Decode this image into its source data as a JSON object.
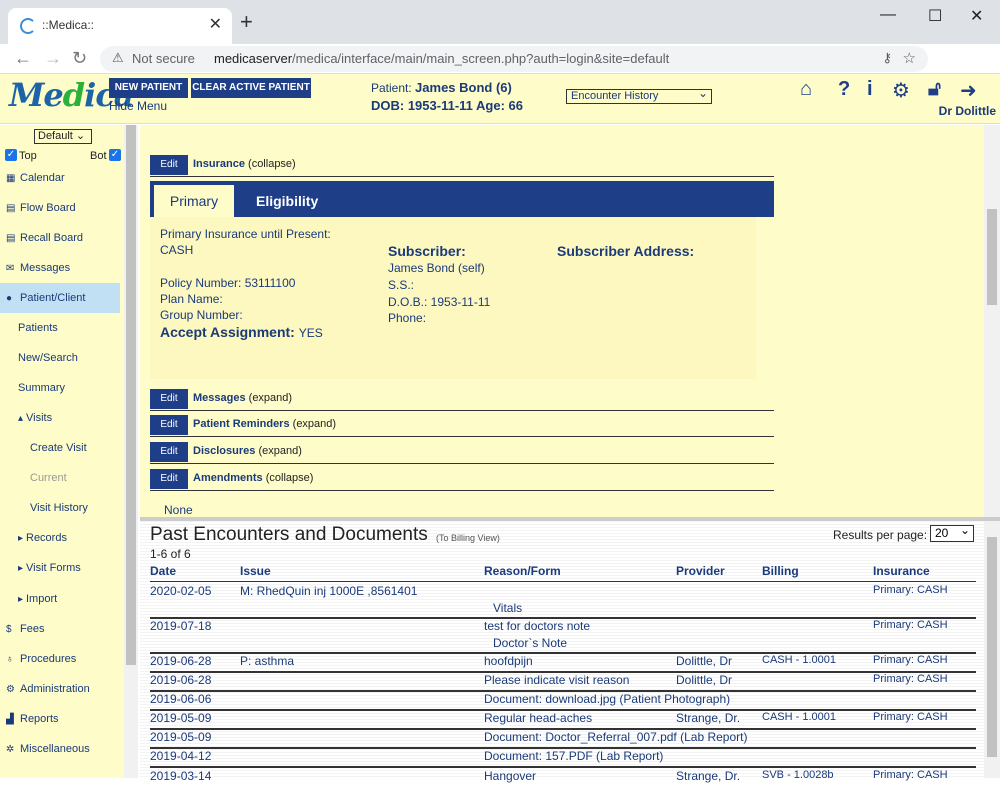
{
  "browser": {
    "tab_title": "::Medica::",
    "not_secure": "Not secure",
    "url_host": "medicaserver",
    "url_path": "/medica/interface/main/main_screen.php?auth=login&site=default"
  },
  "header": {
    "logo_a": "Me",
    "logo_b": "d",
    "logo_c": "ica",
    "new_patient": "NEW PATIENT",
    "clear_patient": "CLEAR ACTIVE PATIENT",
    "hide_menu": "Hide Menu",
    "patient_label": "Patient:",
    "patient_name": "James Bond (6)",
    "dob_line": "DOB: 1953-11-11 Age: 66",
    "encounter_select": "Encounter History",
    "user": "Dr Dolittle"
  },
  "sidebar": {
    "select": "Default",
    "top_label": "Top",
    "bot_label": "Bot",
    "items": [
      {
        "label": "Calendar",
        "icon": "calendar-icon",
        "glyph": "▦"
      },
      {
        "label": "Flow Board",
        "icon": "board-icon",
        "glyph": "▤"
      },
      {
        "label": "Recall Board",
        "icon": "board-icon",
        "glyph": "▤"
      },
      {
        "label": "Messages",
        "icon": "envelope-icon",
        "glyph": "✉"
      },
      {
        "label": "Patient/Client",
        "icon": "user-icon",
        "glyph": "●"
      },
      {
        "label": "Patients"
      },
      {
        "label": "New/Search"
      },
      {
        "label": "Summary"
      },
      {
        "label": "Visits",
        "glyph": "▴"
      },
      {
        "label": "Create Visit"
      },
      {
        "label": "Current"
      },
      {
        "label": "Visit History"
      },
      {
        "label": "Records",
        "glyph": "▸"
      },
      {
        "label": "Visit Forms",
        "glyph": "▸"
      },
      {
        "label": "Import",
        "glyph": "▸"
      },
      {
        "label": "Fees",
        "icon": "dollar-icon",
        "glyph": "$"
      },
      {
        "label": "Procedures",
        "icon": "stethoscope-icon",
        "glyph": "♁"
      },
      {
        "label": "Administration",
        "icon": "cogs-icon",
        "glyph": "⚙"
      },
      {
        "label": "Reports",
        "icon": "chart-icon",
        "glyph": "▟"
      },
      {
        "label": "Miscellaneous",
        "icon": "gear-icon",
        "glyph": "✲"
      }
    ]
  },
  "insurance": {
    "edit": "Edit",
    "title": "Insurance",
    "state": "(collapse)",
    "tab_primary": "Primary",
    "tab_eligibility": "Eligibility",
    "until": "Primary Insurance until Present:",
    "company": "CASH",
    "policy": "Policy Number: 53111100",
    "plan": "Plan Name:",
    "group": "Group Number:",
    "accept_label": "Accept Assignment:",
    "accept_value": "YES",
    "subscriber_head": "Subscriber:",
    "subscriber_name": "James Bond (self)",
    "ss": "S.S.:",
    "dob": "D.O.B.: 1953-11-11",
    "phone": "Phone:",
    "address_head": "Subscriber Address:"
  },
  "sections": [
    {
      "title": "Messages",
      "state": "(expand)"
    },
    {
      "title": "Patient Reminders",
      "state": "(expand)"
    },
    {
      "title": "Disclosures",
      "state": "(expand)"
    },
    {
      "title": "Amendments",
      "state": "(collapse)"
    }
  ],
  "none_text": "None",
  "encounters": {
    "title": "Past Encounters and Documents",
    "billing_view": "(To Billing View)",
    "results_label": "Results per page:",
    "results_value": "20",
    "count": "1-6 of 6",
    "headers": [
      "Date",
      "Issue",
      "Reason/Form",
      "Provider",
      "Billing",
      "Insurance"
    ],
    "rows": [
      {
        "date": "2020-02-05",
        "issue": "M: RhedQuin inj 1000E ,8561401",
        "reason": "",
        "sub": "Vitals",
        "provider": "",
        "billing": "",
        "insurance": "Primary: CASH"
      },
      {
        "date": "2019-07-18",
        "issue": "",
        "reason": "test for doctors note",
        "sub": "Doctor`s Note",
        "provider": "",
        "billing": "",
        "insurance": "Primary: CASH"
      },
      {
        "date": "2019-06-28",
        "issue": "P: asthma",
        "reason": "hoofdpijn",
        "sub": "",
        "provider": "Dolittle, Dr",
        "billing": "CASH - 1.0001",
        "insurance": "Primary: CASH"
      },
      {
        "date": "2019-06-28",
        "issue": "",
        "reason": "Please indicate visit reason",
        "sub": "",
        "provider": "Dolittle, Dr",
        "billing": "",
        "insurance": "Primary: CASH"
      },
      {
        "date": "2019-06-06",
        "issue": "",
        "reason": "Document: download.jpg (Patient Photograph)",
        "sub": "",
        "provider": "",
        "billing": "",
        "insurance": ""
      },
      {
        "date": "2019-05-09",
        "issue": "",
        "reason": "Regular head-aches",
        "sub": "",
        "provider": "Strange, Dr.",
        "billing": "CASH - 1.0001",
        "insurance": "Primary: CASH"
      },
      {
        "date": "2019-05-09",
        "issue": "",
        "reason": "Document: Doctor_Referral_007.pdf (Lab Report)",
        "sub": "",
        "provider": "",
        "billing": "",
        "insurance": ""
      },
      {
        "date": "2019-04-12",
        "issue": "",
        "reason": "Document: 157.PDF (Lab Report)",
        "sub": "",
        "provider": "",
        "billing": "",
        "insurance": ""
      },
      {
        "date": "2019-03-14",
        "issue": "",
        "reason": "Hangover",
        "sub": "",
        "provider": "Strange, Dr.",
        "billing": "SVB - 1.0028b",
        "insurance": "Primary: CASH"
      }
    ]
  }
}
